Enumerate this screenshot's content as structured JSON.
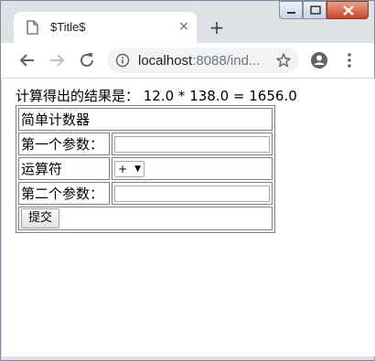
{
  "browser": {
    "tab_title": "$Title$",
    "tab_close": "×",
    "new_tab": "+",
    "url_host": "localhost",
    "url_rest": ":8088/ind...",
    "window_controls": [
      "minimize",
      "maximize",
      "close"
    ]
  },
  "page": {
    "result_text": "计算得出的结果是： 12.0 * 138.0 = 1656.0",
    "table_title": "简单计数器",
    "label_first": "第一个参数：",
    "label_operator": "运算符",
    "label_second": "第二个参数：",
    "first_value": "",
    "second_value": "",
    "operator_selected": "+",
    "submit_label": "提交"
  },
  "colors": {
    "tab_strip": "#dee1e6",
    "omnibox_bg": "#f1f3f4",
    "table_border": "#808080"
  }
}
